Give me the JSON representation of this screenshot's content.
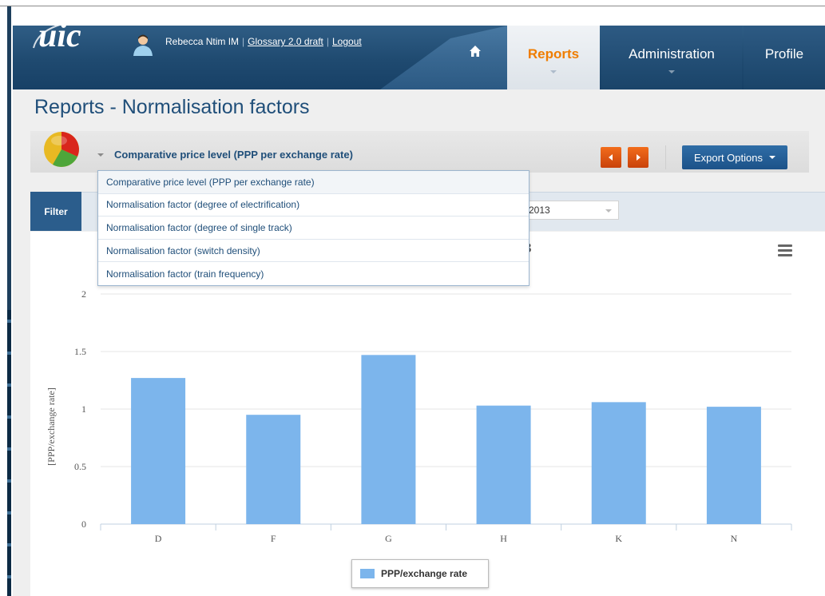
{
  "header": {
    "user_name": "Rebecca Ntim IM",
    "glossary_link": "Glossary 2.0 draft",
    "logout_link": "Logout",
    "tabs": [
      {
        "label": "Reports",
        "active": true
      },
      {
        "label": "Administration",
        "active": false
      },
      {
        "label": "Profile",
        "active": false
      }
    ]
  },
  "page": {
    "title": "Reports - Normalisation factors"
  },
  "selector": {
    "selected": "Comparative price level (PPP per exchange rate)",
    "options": [
      "Comparative price level (PPP per exchange rate)",
      "Normalisation factor (degree of electrification)",
      "Normalisation factor (degree of single track)",
      "Normalisation factor (switch density)",
      "Normalisation factor (train frequency)"
    ]
  },
  "toolbar": {
    "export_label": "Export Options"
  },
  "filter": {
    "button_label": "Filter",
    "year_value": "2013"
  },
  "chart_title_visible": "3",
  "chart_data": {
    "type": "bar",
    "categories": [
      "D",
      "F",
      "G",
      "H",
      "K",
      "N"
    ],
    "series": [
      {
        "name": "PPP/exchange rate",
        "values": [
          1.27,
          0.95,
          1.47,
          1.03,
          1.06,
          1.02
        ],
        "color": "#7cb5ec"
      }
    ],
    "ylabel": "[PPP/exchange rate]",
    "ylim": [
      0,
      2
    ],
    "yticks": [
      "0",
      "0.5",
      "1",
      "1.5",
      "2"
    ],
    "grid": true,
    "legend": "bottom-center"
  },
  "colors": {
    "accent_orange": "#ef7d00",
    "brand_blue": "#1f4e79",
    "bar_blue": "#7cb5ec"
  }
}
